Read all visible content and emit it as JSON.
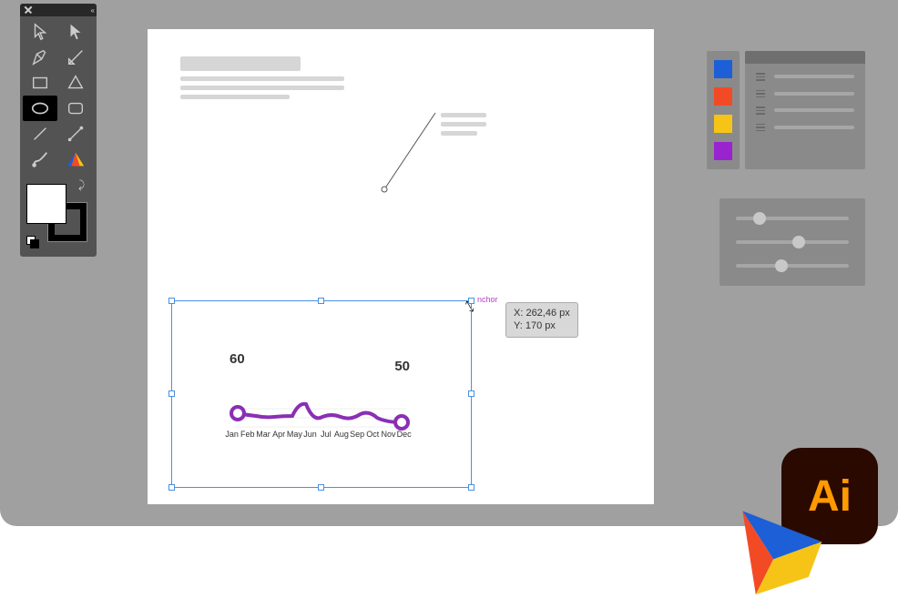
{
  "tooltip": {
    "x_label": "X: 262,46 px",
    "y_label": "Y: 170 px"
  },
  "anchor_label": "nchor",
  "colors": {
    "blue": "#1d5fd6",
    "red": "#f34a26",
    "yellow": "#f5c416",
    "purple": "#9a23d0"
  },
  "sliders": [
    15,
    50,
    35
  ],
  "chart_data": {
    "type": "line",
    "title": "",
    "xlabel": "",
    "ylabel": "",
    "categories": [
      "Jan",
      "Feb",
      "Mar",
      "Apr",
      "May",
      "Jun",
      "Jul",
      "Aug",
      "Sep",
      "Oct",
      "Nov",
      "Dec"
    ],
    "values": [
      60,
      57,
      56,
      55,
      56,
      64,
      52,
      56,
      54,
      57,
      53,
      50
    ],
    "start_label": "60",
    "end_label": "50",
    "ylim": [
      40,
      70
    ]
  },
  "tool_names": [
    "selection",
    "direct-selection",
    "pen",
    "add-anchor",
    "rectangle",
    "polygon",
    "ellipse",
    "rounded-rect",
    "line",
    "segment",
    "brush",
    "color-wheel"
  ],
  "selected_tool": "ellipse",
  "logo_text": "Ai"
}
